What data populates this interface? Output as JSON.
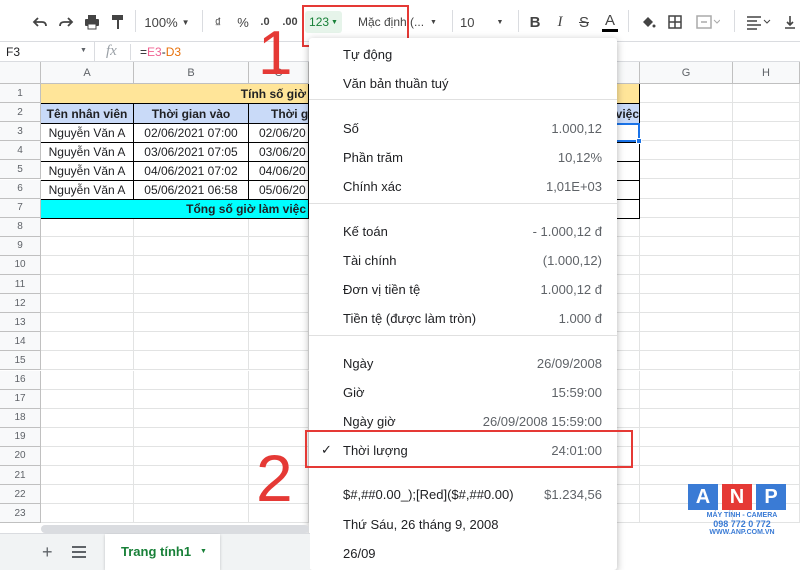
{
  "toolbar": {
    "zoom": "100%",
    "currency": "₫",
    "percent": "%",
    "dec_decrease": ".0",
    "dec_increase": ".00",
    "format_btn": "123",
    "font": "Mặc định (...",
    "font_size": "10",
    "bold": "B",
    "italic": "I",
    "strike": "S",
    "text_color": "A"
  },
  "formula_bar": {
    "cell_ref": "F3",
    "fx": "fx",
    "eq": "=",
    "ref1": "E3",
    "op": "-",
    "ref2": "D3"
  },
  "columns": [
    "A",
    "B",
    "C",
    "G",
    "H"
  ],
  "rows": [
    "1",
    "2",
    "3",
    "4",
    "5",
    "6",
    "7",
    "8",
    "9",
    "10",
    "11",
    "12",
    "13",
    "14",
    "15",
    "16",
    "17",
    "18",
    "19",
    "20",
    "21",
    "22",
    "23"
  ],
  "sheet": {
    "title": "Tính số giờ",
    "headers": [
      "Tên nhân viên",
      "Thời gian vào",
      "Thời gi",
      "việc"
    ],
    "data": [
      [
        "Nguyễn Văn A",
        "02/06/2021 07:00",
        "02/06/20"
      ],
      [
        "Nguyễn Văn A",
        "03/06/2021 07:05",
        "03/06/20"
      ],
      [
        "Nguyễn Văn A",
        "04/06/2021 07:02",
        "04/06/20"
      ],
      [
        "Nguyễn Văn A",
        "05/06/2021 06:58",
        "05/06/20"
      ]
    ],
    "total": "Tổng số giờ làm việc"
  },
  "menu": {
    "groups": [
      [
        {
          "label": "Tự động",
          "value": ""
        },
        {
          "label": "Văn bản thuần tuý",
          "value": ""
        }
      ],
      [
        {
          "label": "Số",
          "value": "1.000,12"
        },
        {
          "label": "Phần trăm",
          "value": "10,12%"
        },
        {
          "label": "Chính xác",
          "value": "1,01E+03"
        }
      ],
      [
        {
          "label": "Kế toán",
          "value": "- 1.000,12 đ"
        },
        {
          "label": "Tài chính",
          "value": "(1.000,12)"
        },
        {
          "label": "Đơn vị tiền tệ",
          "value": "1.000,12 đ"
        },
        {
          "label": "Tiền tệ (được làm tròn)",
          "value": "1.000 đ"
        }
      ],
      [
        {
          "label": "Ngày",
          "value": "26/09/2008"
        },
        {
          "label": "Giờ",
          "value": "15:59:00"
        },
        {
          "label": "Ngày giờ",
          "value": "26/09/2008 15:59:00"
        },
        {
          "label": "Thời lượng",
          "value": "24:01:00"
        }
      ],
      [
        {
          "label": "$#,##0.00_);[Red]($#,##0.00)",
          "value": "$1.234,56"
        },
        {
          "label": "Thứ Sáu, 26 tháng 9, 2008",
          "value": ""
        },
        {
          "label": "26/09",
          "value": ""
        }
      ]
    ]
  },
  "annotations": {
    "step1": "1",
    "step2": "2"
  },
  "tabs": {
    "sheet_tab": "Trang tính1"
  },
  "watermark": {
    "brand": "ANP",
    "line1": "MÁY TÍNH - CAMERA",
    "line2": "098 772 0 772",
    "line3": "WWW.ANP.COM.VN"
  },
  "colors": {
    "title_bg": "#ffe599",
    "header_bg": "#c9daf8",
    "total_bg": "#00ffff",
    "annotation_red": "#e53935",
    "tab_green": "#188038"
  }
}
